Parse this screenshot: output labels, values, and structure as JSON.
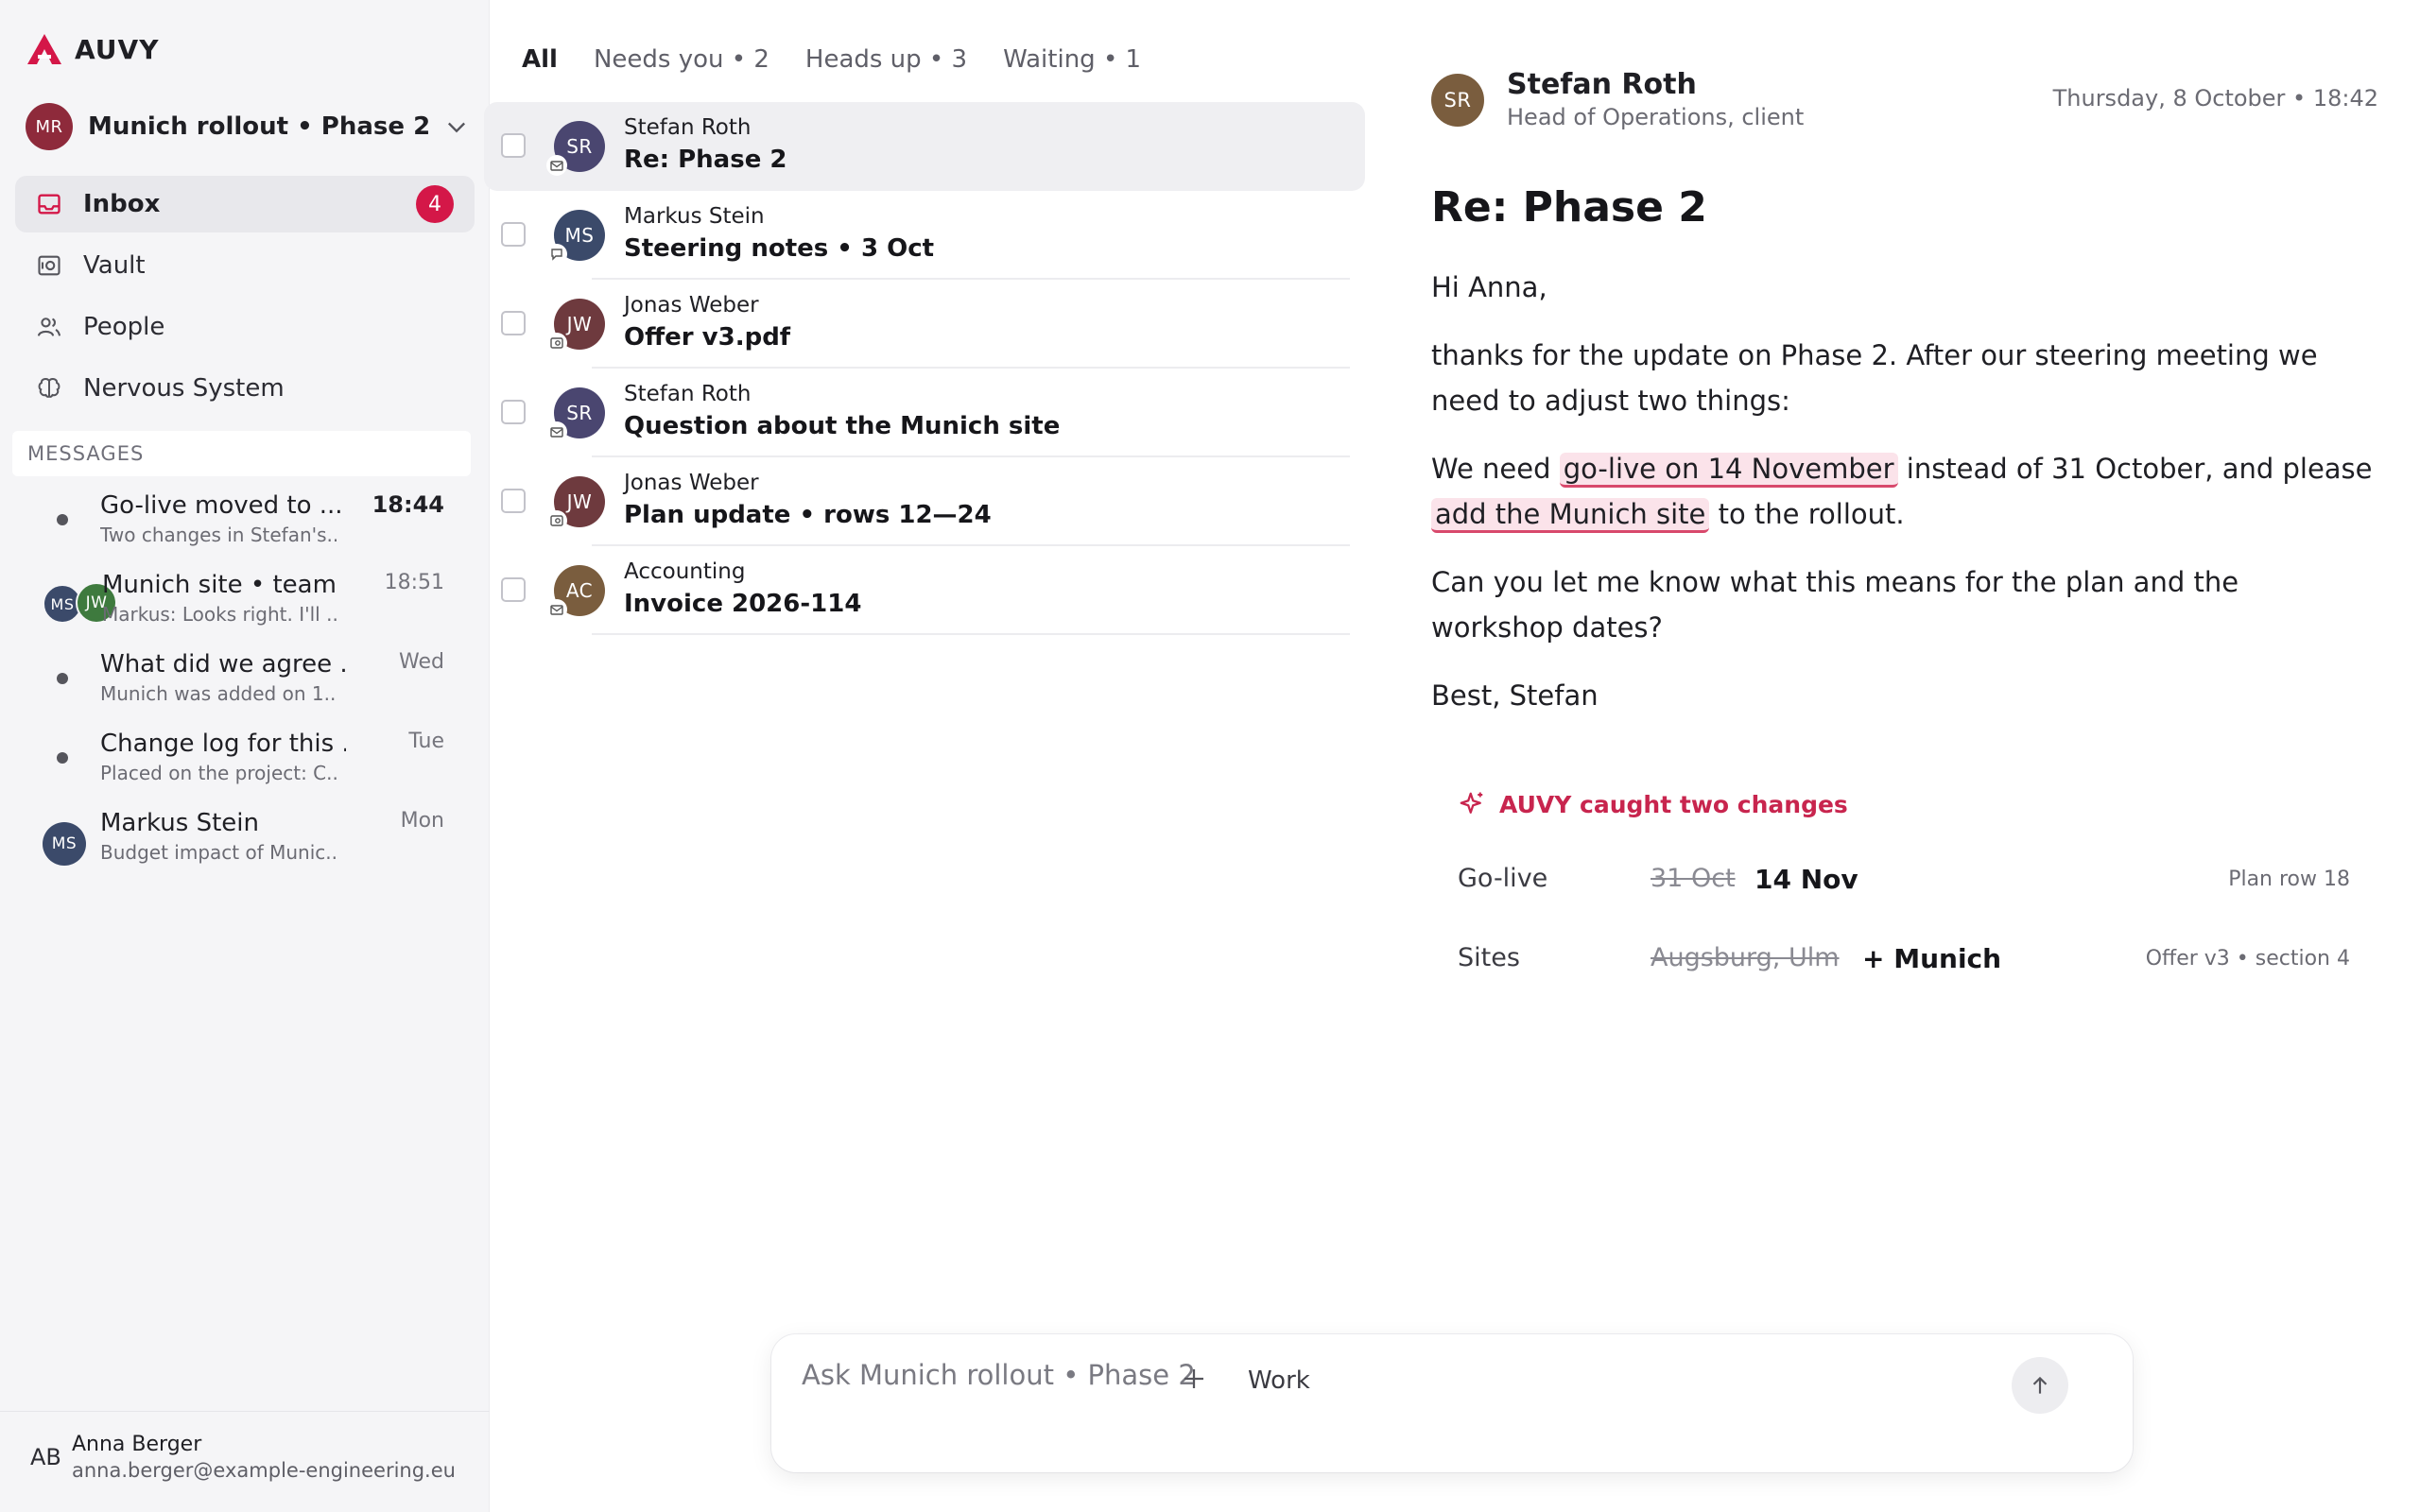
{
  "brand": {
    "name": "AUVY",
    "accent": "#d41748"
  },
  "project": {
    "initials": "MR",
    "name": "Munich rollout • Phase 2"
  },
  "nav": [
    {
      "label": "Inbox",
      "icon": "inbox-icon",
      "badge": "4",
      "active": true
    },
    {
      "label": "Vault",
      "icon": "vault-icon"
    },
    {
      "label": "People",
      "icon": "people-icon"
    },
    {
      "label": "Nervous System",
      "icon": "brain-icon"
    }
  ],
  "messages_header": "MESSAGES",
  "messages": [
    {
      "title": "Go-live moved to ...",
      "sub": "Two changes in Stefan's...",
      "time": "18:44"
    },
    {
      "title": "Munich site • team",
      "sub": "Markus: Looks right. I'll ...",
      "time": "18:51",
      "avatar1": "MS",
      "avatar2": "JW"
    },
    {
      "title": "What did we agree ...",
      "sub": "Munich was added on 1...",
      "time": "Wed"
    },
    {
      "title": "Change log for this ...",
      "sub": "Placed on the project: C...",
      "time": "Tue"
    },
    {
      "title": "Markus Stein",
      "sub": "Budget impact of Munic...",
      "time": "Mon",
      "avatar": "MS"
    }
  ],
  "user": {
    "initials": "AB",
    "name": "Anna Berger",
    "email": "anna.berger@example-engineering.eu"
  },
  "filters": [
    "All",
    "Needs you • 2",
    "Heads up • 3",
    "Waiting • 1"
  ],
  "inbox": [
    {
      "initials": "SR",
      "from": "Stefan Roth",
      "subject": "Re: Phase 2",
      "color": "#4a4670",
      "channel": "mail-icon"
    },
    {
      "initials": "MS",
      "from": "Markus Stein",
      "subject": "Steering notes • 3 Oct",
      "color": "#3b4a6a",
      "channel": "chat-icon"
    },
    {
      "initials": "JW",
      "from": "Jonas Weber",
      "subject": "Offer v3.pdf",
      "color": "#6e3a3e",
      "channel": "file-icon"
    },
    {
      "initials": "SR",
      "from": "Stefan Roth",
      "subject": "Question about the Munich site",
      "color": "#4a4670",
      "channel": "mail-icon"
    },
    {
      "initials": "JW",
      "from": "Jonas Weber",
      "subject": "Plan update • rows 12—24",
      "color": "#6e3a3e",
      "channel": "file-icon"
    },
    {
      "initials": "AC",
      "from": "Accounting",
      "subject": "Invoice 2026-114",
      "color": "#7a5d3e",
      "channel": "mail-icon"
    }
  ],
  "detail": {
    "initials": "SR",
    "from": "Stefan Roth",
    "role": "Head of Operations, client",
    "date": "Thursday, 8 October • 18:42",
    "subject": "Re: Phase 2",
    "greeting": "Hi Anna,",
    "p1": "thanks for the update on Phase 2. After our steering meeting we need to adjust two things:",
    "p2_a": "We need ",
    "p2_hl1": "go-live on 14 November",
    "p2_b": " instead of 31 October, and please ",
    "p2_hl2": "add the Munich site",
    "p2_c": " to the rollout.",
    "p3": "Can you let me know what this means for the plan and the workshop dates?",
    "sign": "Best, Stefan"
  },
  "changes": {
    "title": "AUVY caught two changes",
    "rows": [
      {
        "key": "Go-live",
        "old": "31 Oct",
        "new": "14 Nov",
        "ref": "Plan row 18"
      },
      {
        "key": "Sites",
        "old": "Augsburg, Ulm",
        "new": "+ Munich",
        "ref": "Offer v3 • section 4"
      }
    ]
  },
  "composer": {
    "placeholder": "Ask Munich rollout • Phase 2",
    "mode": "Work"
  }
}
